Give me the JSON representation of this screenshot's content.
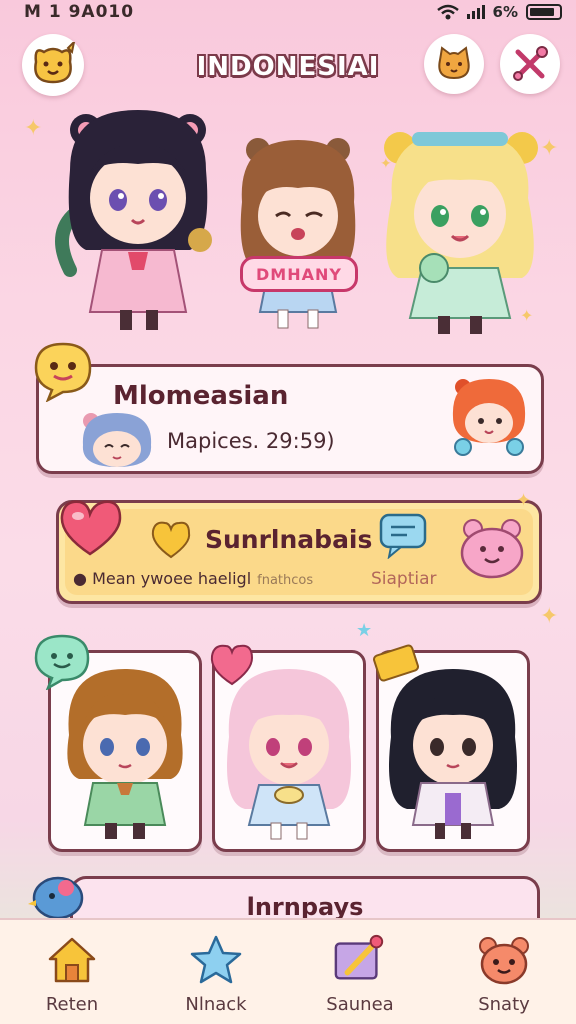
{
  "status_bar": {
    "time": "M 1 9A010",
    "battery": "6%",
    "battery_level": 0.85
  },
  "header": {
    "title": "INDONESIAI"
  },
  "hero": {
    "sign_text": "DMHANY"
  },
  "card_1": {
    "title": "Mlomeasian",
    "subtitle": "Mapices. 29:59)"
  },
  "card_2": {
    "title": "Sunrlnabais",
    "desc": "Mean ywoee haeligl",
    "desc_muted": "fnathcos",
    "tag": "Siaptiar"
  },
  "card_3": {
    "title": "lnrnpays"
  },
  "nav": {
    "items": [
      {
        "label": "Reten",
        "icon": "home-icon"
      },
      {
        "label": "Nlnack",
        "icon": "star-icon"
      },
      {
        "label": "Saunea",
        "icon": "brush-icon"
      },
      {
        "label": "Snaty",
        "icon": "bear-icon"
      }
    ]
  },
  "colors": {
    "accent": "#7a3d4c",
    "background": "#f9c9dc",
    "gold": "#fbd98a"
  }
}
